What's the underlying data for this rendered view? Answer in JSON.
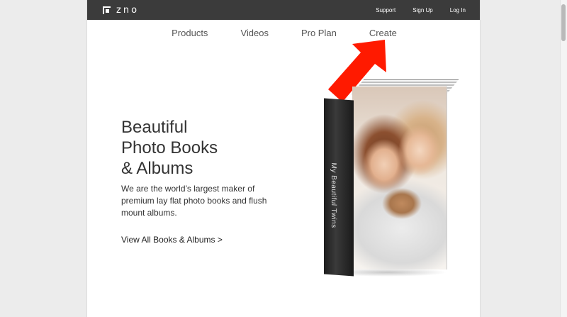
{
  "topbar": {
    "logo_text": "zno",
    "links": [
      "Support",
      "Sign Up",
      "Log In"
    ]
  },
  "nav": {
    "items": [
      "Products",
      "Videos",
      "Pro Plan",
      "Create"
    ]
  },
  "hero": {
    "title_lines": [
      "Beautiful",
      "Photo Books",
      "& Albums"
    ],
    "description": "We are the world’s largest maker of premium lay flat photo books and flush mount albums.",
    "link_text": "View All Books & Albums >"
  },
  "book": {
    "spine_text": "My Beautiful Twins"
  },
  "colors": {
    "topbar_bg": "#3b3b3b",
    "arrow": "#ff1a00",
    "page_bg": "#ffffff",
    "body_bg": "#ececec"
  }
}
